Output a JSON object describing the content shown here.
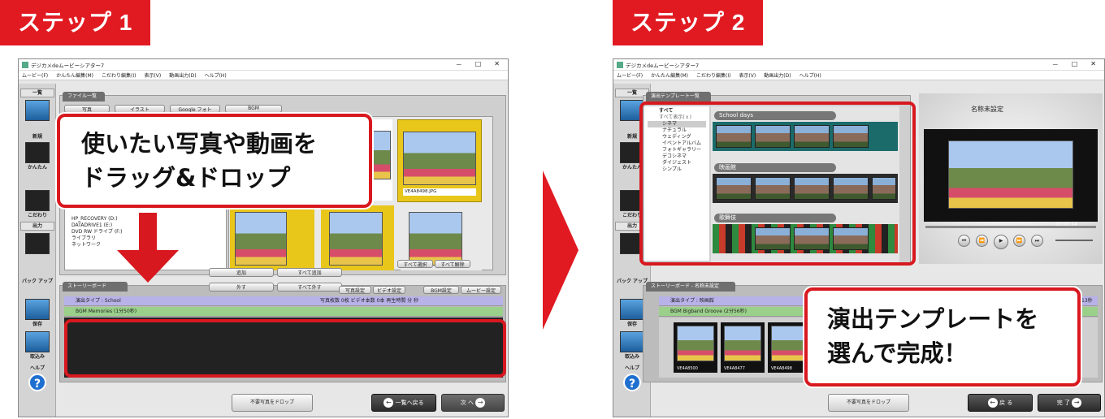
{
  "step1": {
    "tag": "ステップ 1",
    "window_title": "デジカメdeムービーシアター7",
    "menu": [
      "ムービー(F)",
      "かんたん編集(M)",
      "こだわり編集(I)",
      "表示(V)",
      "動画出力(D)",
      "ヘルプ(H)"
    ],
    "left_labels": [
      "一覧",
      "新規",
      "かんたん",
      "こだわり",
      "出力",
      "バック アップ",
      "保存",
      "取込み",
      "ヘルプ"
    ],
    "file_tab": "ファイル一覧",
    "source_tabs": [
      "写真",
      "イラスト",
      "Google フォト",
      "BGM"
    ],
    "tree_items": [
      "HP_RECOVERY (D:)",
      "DATADRIVE1 (E:)",
      "DVD RW ドライブ (F:)",
      "ライブラリ",
      "ネットワーク"
    ],
    "selected_photo_label": "VE4A8498.JPG",
    "add_button": "追加",
    "add_all_button": "すべて追加",
    "select_all": "すべて選択",
    "deselect_all": "すべて解除",
    "storyboard_tab": "ストーリーボード",
    "remove_button": "外す",
    "remove_all_button": "すべて外す",
    "photo_settings": "写真設定",
    "video_settings": "ビデオ設定",
    "bgm_settings": "BGM設定",
    "movie_settings": "ムービー設定",
    "tl_row1": "演出タイプ : School",
    "tl_row1_stats": "写真枚数 0枚   ビデオ本数 0本   再生時間 分 秒",
    "tl_row2": "BGM Memories (1分50秒)",
    "callout": "使いたい写真や動画を ドラッグ&ドロップ",
    "delete_unused": "不要写真をドロップ",
    "back_button": "一覧へ戻る",
    "next_button": "次 へ"
  },
  "step2": {
    "tag": "ステップ 2",
    "window_title": "デジカメdeムービーシアター7",
    "menu": [
      "ムービー(F)",
      "かんたん編集(M)",
      "こだわり編集(I)",
      "表示(V)",
      "動画出力(D)",
      "ヘルプ(H)"
    ],
    "left_labels": [
      "一覧",
      "新規",
      "かんたん",
      "こだわり",
      "出力",
      "バック アップ",
      "保存",
      "取込み",
      "ヘルプ"
    ],
    "template_tab": "演出テンプレート一覧",
    "categories": [
      "すべて",
      "すべて表示(ｘ)",
      "シネマ",
      "ナチュラル",
      "ウェディング",
      "イベントアルバム",
      "フォトギャラリー",
      "デコシネマ",
      "ダイジェスト",
      "シンプル"
    ],
    "template_groups": [
      "School days",
      "映画館",
      "歌舞伎"
    ],
    "preview_title": "名称未設定",
    "preview_time": "00:00:14",
    "storyboard_tab": "ストーリーボード - 名称未設定",
    "tl_row1": "演出タイプ : 映画館",
    "tl_row1_stats": "13秒",
    "tl_row2": "BGM Bigband Groove (2分56秒)",
    "film_labels": [
      "VE4A8500",
      "VE4A8477",
      "VE4A8498"
    ],
    "callout": "演出テンプレートを 選んで完成！",
    "delete_unused": "不要写真をドロップ",
    "back_button": "戻 る",
    "finish_button": "完 了"
  },
  "colors": {
    "accent": "#e11a22",
    "highlight": "#e8c61a"
  }
}
